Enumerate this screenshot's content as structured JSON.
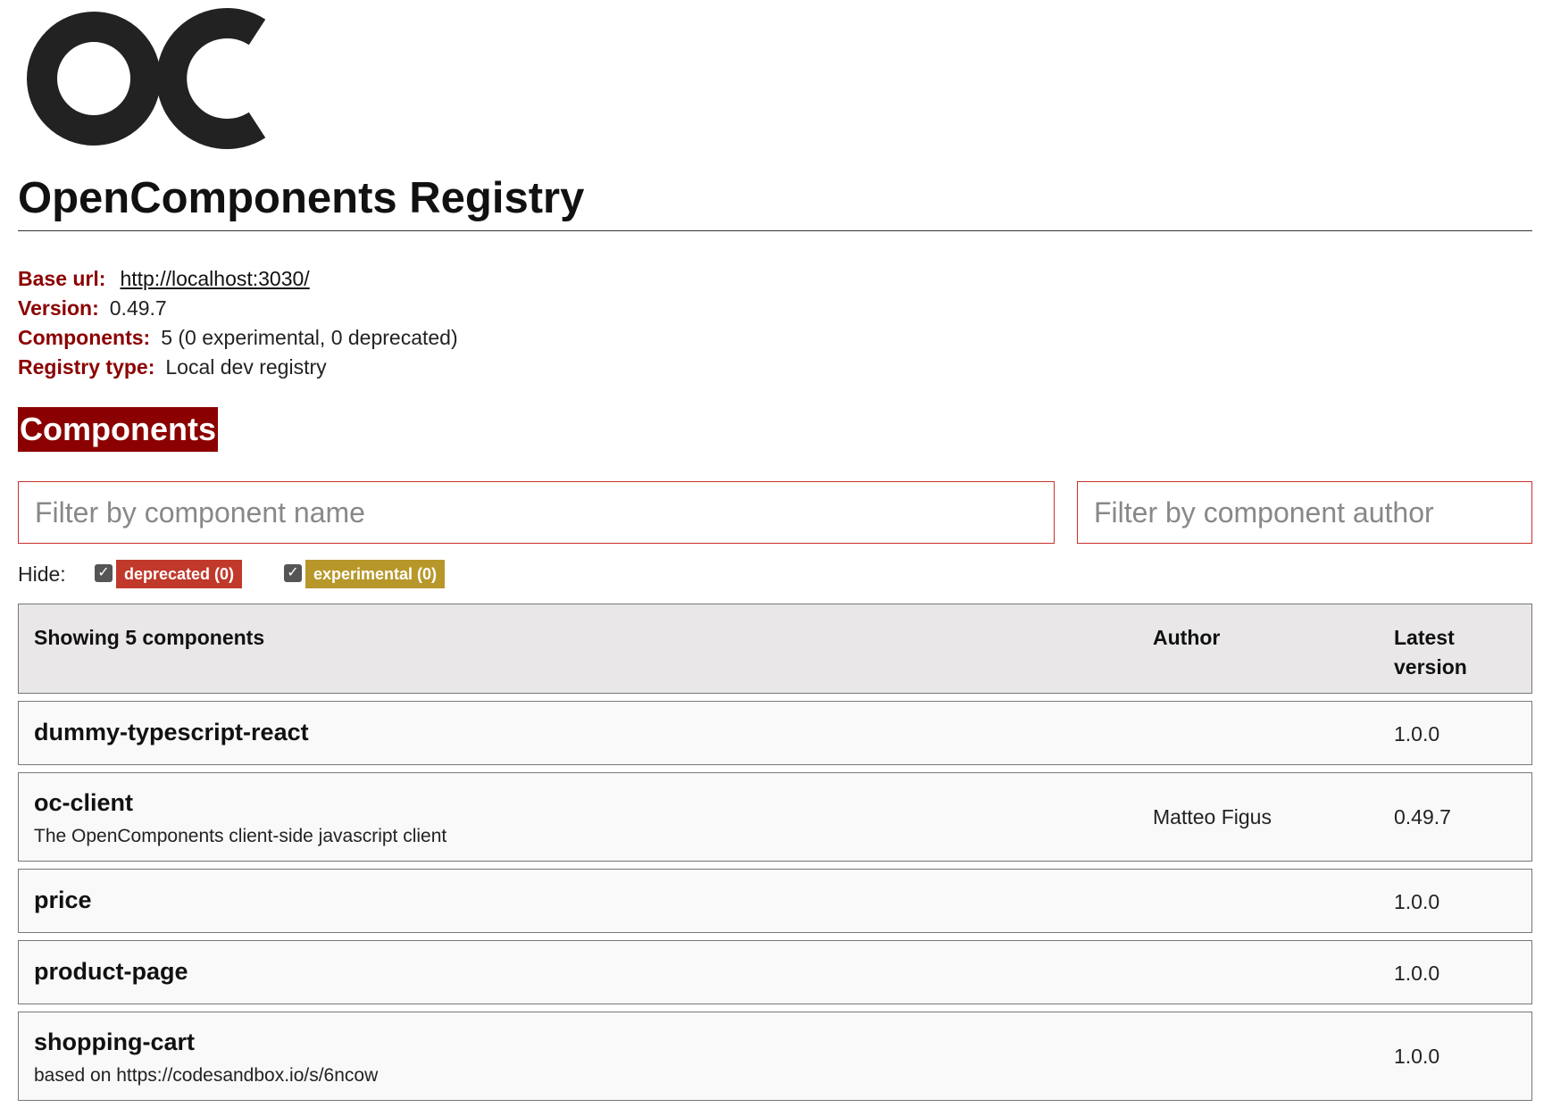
{
  "logo": {
    "icon": "oc-logo-icon",
    "text": "OC",
    "color": "#222222"
  },
  "page": {
    "title": "OpenComponents Registry"
  },
  "info": {
    "base_url_label": "Base url:",
    "base_url": "http://localhost:3030/",
    "version_label": "Version:",
    "version": "0.49.7",
    "components_label": "Components:",
    "components": "5 (0 experimental, 0 deprecated)",
    "registry_type_label": "Registry type:",
    "registry_type": "Local dev registry"
  },
  "section": {
    "title": "Components"
  },
  "filters": {
    "name_placeholder": "Filter by component name",
    "author_placeholder": "Filter by component author"
  },
  "hide": {
    "label": "Hide:",
    "deprecated": {
      "label": "deprecated (0)",
      "checked": true,
      "color": "#c0392b"
    },
    "experimental": {
      "label": "experimental (0)",
      "checked": true,
      "color": "#b8972a"
    }
  },
  "table": {
    "headers": {
      "name": "Showing 5 components",
      "author": "Author",
      "version": "Latest version"
    },
    "rows": [
      {
        "name": "dummy-typescript-react",
        "description": "",
        "author": "",
        "version": "1.0.0"
      },
      {
        "name": "oc-client",
        "description": "The OpenComponents client-side javascript client",
        "author": "Matteo Figus",
        "version": "0.49.7"
      },
      {
        "name": "price",
        "description": "",
        "author": "",
        "version": "1.0.0"
      },
      {
        "name": "product-page",
        "description": "",
        "author": "",
        "version": "1.0.0"
      },
      {
        "name": "shopping-cart",
        "description": "based on https://codesandbox.io/s/6ncow",
        "author": "",
        "version": "1.0.0"
      }
    ]
  },
  "colors": {
    "accent": "#8b0000",
    "border": "#c9302c"
  }
}
